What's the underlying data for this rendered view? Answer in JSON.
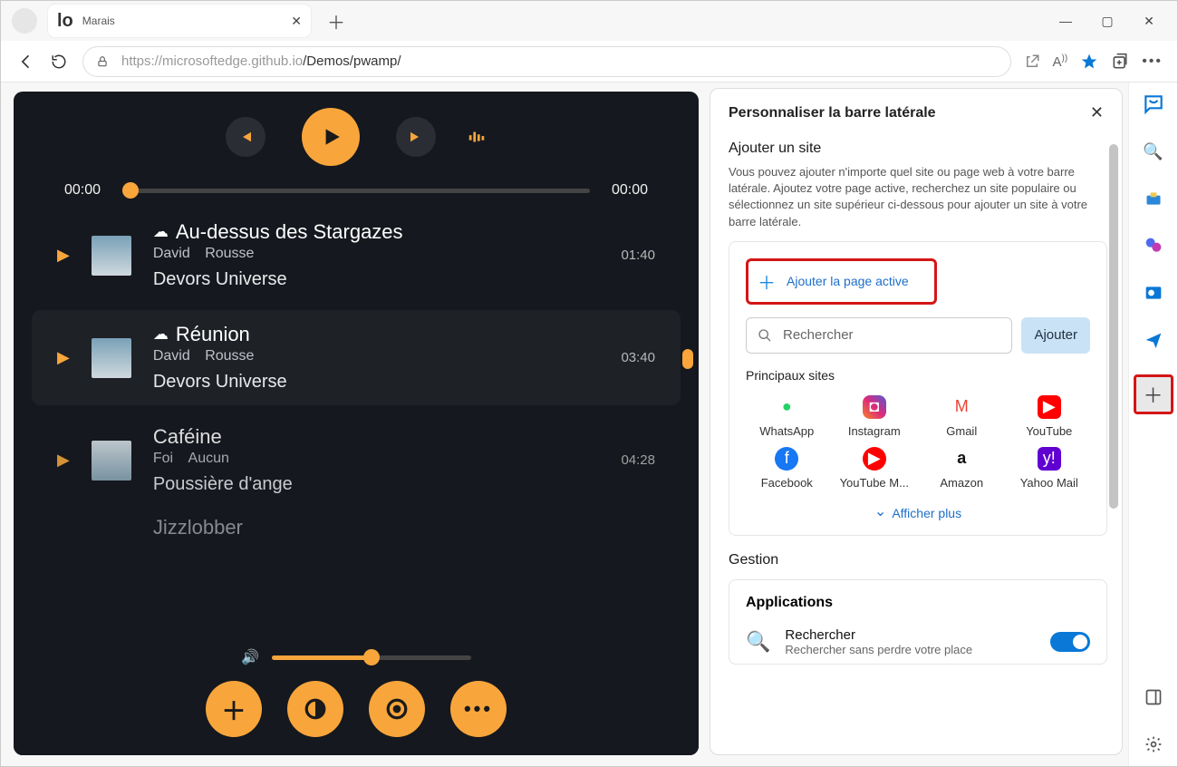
{
  "tab": {
    "favicon_text": "lo",
    "title": "Marais"
  },
  "url": {
    "scheme_host": "https://microsoftedge.github.io",
    "path": "/Demos/pwamp/"
  },
  "player": {
    "time_current": "00:00",
    "time_total": "00:00",
    "tracks": [
      {
        "title": "Au-dessus des Stargazes",
        "artist": "David",
        "extra": "Rousse",
        "album": "Devors Universe",
        "duration": "01:40"
      },
      {
        "title": "Réunion",
        "artist": "David",
        "extra": "Rousse",
        "album": "Devors Universe",
        "duration": "03:40"
      },
      {
        "title": "Caféine",
        "artist": "Foi",
        "extra": "Aucun",
        "album": "Poussière d'ange",
        "duration": "04:28"
      },
      {
        "title": "Jizzlobber",
        "artist": "",
        "extra": "",
        "album": "",
        "duration": ""
      }
    ]
  },
  "sidepanel": {
    "title": "Personnaliser la barre latérale",
    "add_site_heading": "Ajouter un site",
    "desc": "Vous pouvez ajouter n'importe quel site ou page web à votre barre latérale. Ajoutez votre page active, recherchez un site populaire ou sélectionnez un site supérieur ci-dessous pour ajouter un site à votre barre latérale.",
    "add_current_label": "Ajouter la page active",
    "search_placeholder": "Rechercher",
    "add_button": "Ajouter",
    "top_sites_label": "Principaux sites",
    "sites": [
      {
        "name": "WhatsApp"
      },
      {
        "name": "Instagram"
      },
      {
        "name": "Gmail"
      },
      {
        "name": "YouTube"
      },
      {
        "name": "Facebook"
      },
      {
        "name": "YouTube M..."
      },
      {
        "name": "Amazon"
      },
      {
        "name": "Yahoo Mail"
      }
    ],
    "show_more": "Afficher plus",
    "mgmt_heading": "Gestion",
    "apps_heading": "Applications",
    "apps": [
      {
        "name": "Rechercher",
        "sub": "Rechercher sans perdre votre place"
      }
    ]
  }
}
